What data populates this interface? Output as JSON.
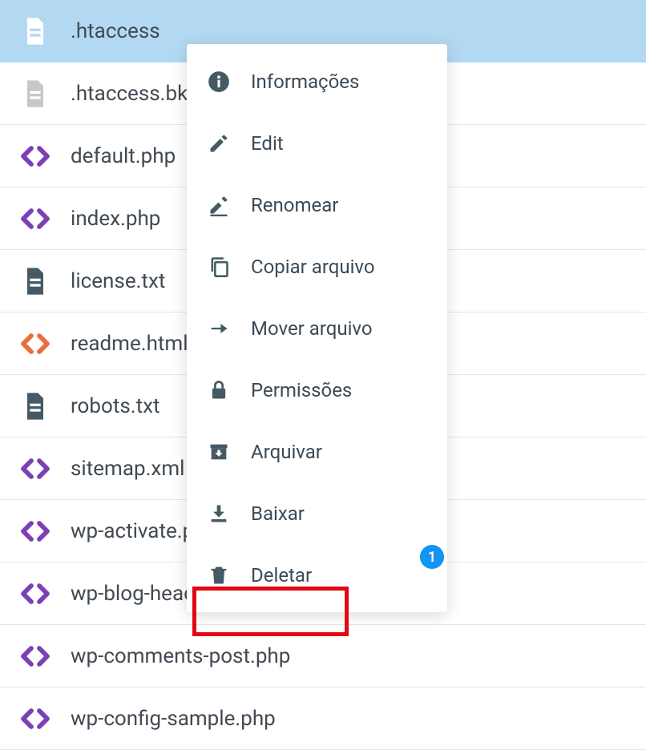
{
  "files": [
    {
      "name": ".htaccess",
      "icon": "doc-white",
      "selected": true
    },
    {
      "name": ".htaccess.bk",
      "icon": "doc-gray"
    },
    {
      "name": "default.php",
      "icon": "code-purple"
    },
    {
      "name": "index.php",
      "icon": "code-purple"
    },
    {
      "name": "license.txt",
      "icon": "doc-slategray"
    },
    {
      "name": "readme.html",
      "icon": "code-orange"
    },
    {
      "name": "robots.txt",
      "icon": "doc-slategray"
    },
    {
      "name": "sitemap.xml",
      "icon": "code-purple"
    },
    {
      "name": "wp-activate.php",
      "icon": "code-purple"
    },
    {
      "name": "wp-blog-header.php",
      "icon": "code-purple"
    },
    {
      "name": "wp-comments-post.php",
      "icon": "code-purple"
    },
    {
      "name": "wp-config-sample.php",
      "icon": "code-purple"
    }
  ],
  "menu": {
    "items": [
      {
        "label": "Informações",
        "icon": "info"
      },
      {
        "label": "Edit",
        "icon": "edit"
      },
      {
        "label": "Renomear",
        "icon": "rename"
      },
      {
        "label": "Copiar arquivo",
        "icon": "copy"
      },
      {
        "label": "Mover arquivo",
        "icon": "move"
      },
      {
        "label": "Permissões",
        "icon": "lock"
      },
      {
        "label": "Arquivar",
        "icon": "archive"
      },
      {
        "label": "Baixar",
        "icon": "download"
      },
      {
        "label": "Deletar",
        "icon": "delete"
      }
    ]
  },
  "badge": {
    "value": "1"
  },
  "colors": {
    "selected_bg": "#b3d9f2",
    "icon_slate": "#455a64",
    "icon_purple": "#7c3fb5",
    "icon_orange": "#e86f3b",
    "icon_gray": "#c7c7c7",
    "badge_bg": "#1296f0",
    "highlight": "#e30613"
  }
}
